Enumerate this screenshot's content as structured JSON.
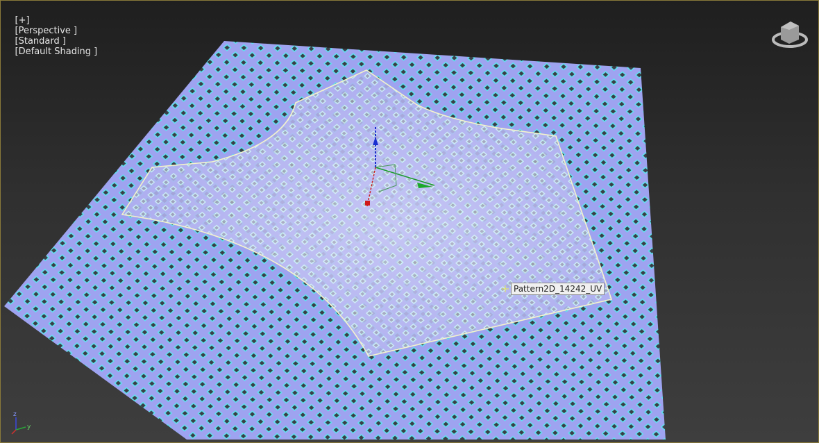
{
  "viewport": {
    "labels": [
      "[+]",
      "[Perspective ]",
      "[Standard ]",
      "[Default Shading ]"
    ]
  },
  "object_label": "Pattern2D_14242_UV",
  "gizmo_axes": {
    "x": "x",
    "y": "y",
    "z": "z"
  },
  "colors": {
    "lattice": "#9ea3f0",
    "lattice_edge": "#5fe3f0",
    "panel_outline": "#f2f2c8",
    "selection": "#e6e650"
  }
}
